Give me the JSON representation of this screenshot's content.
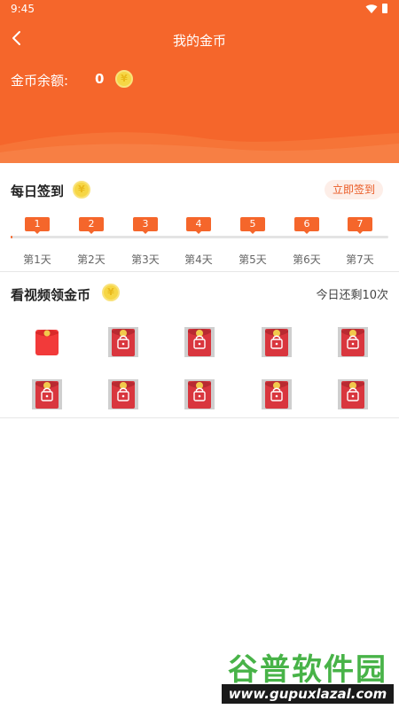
{
  "status_bar": {
    "time": "9:45"
  },
  "header": {
    "title": "我的金币",
    "balance_label": "金币余额:",
    "balance_value": "0"
  },
  "checkin": {
    "title": "每日签到",
    "button_label": "立即签到",
    "progress": 0,
    "days": [
      {
        "number": "1",
        "label": "第1天"
      },
      {
        "number": "2",
        "label": "第2天"
      },
      {
        "number": "3",
        "label": "第3天"
      },
      {
        "number": "4",
        "label": "第4天"
      },
      {
        "number": "5",
        "label": "第5天"
      },
      {
        "number": "6",
        "label": "第6天"
      },
      {
        "number": "7",
        "label": "第7天"
      }
    ]
  },
  "video": {
    "title": "看视频领金币",
    "remaining": "今日还剩10次",
    "envelopes": [
      {
        "state": "unlocked"
      },
      {
        "state": "locked"
      },
      {
        "state": "locked"
      },
      {
        "state": "locked"
      },
      {
        "state": "locked"
      },
      {
        "state": "locked"
      },
      {
        "state": "locked"
      },
      {
        "state": "locked"
      },
      {
        "state": "locked"
      },
      {
        "state": "locked"
      }
    ]
  },
  "watermark": {
    "text": "谷普软件园",
    "url": "www.gupuxlazal.com"
  },
  "colors": {
    "accent": "#f5662b",
    "coin": "#f6d645",
    "envelope": "#d9363e"
  },
  "coin_symbol": "¥",
  "icons": {
    "back": "chevron-left-icon",
    "wifi": "wifi-icon",
    "battery": "battery-icon",
    "coin": "coin-icon",
    "envelope": "red-envelope-icon",
    "lock": "lock-icon"
  }
}
